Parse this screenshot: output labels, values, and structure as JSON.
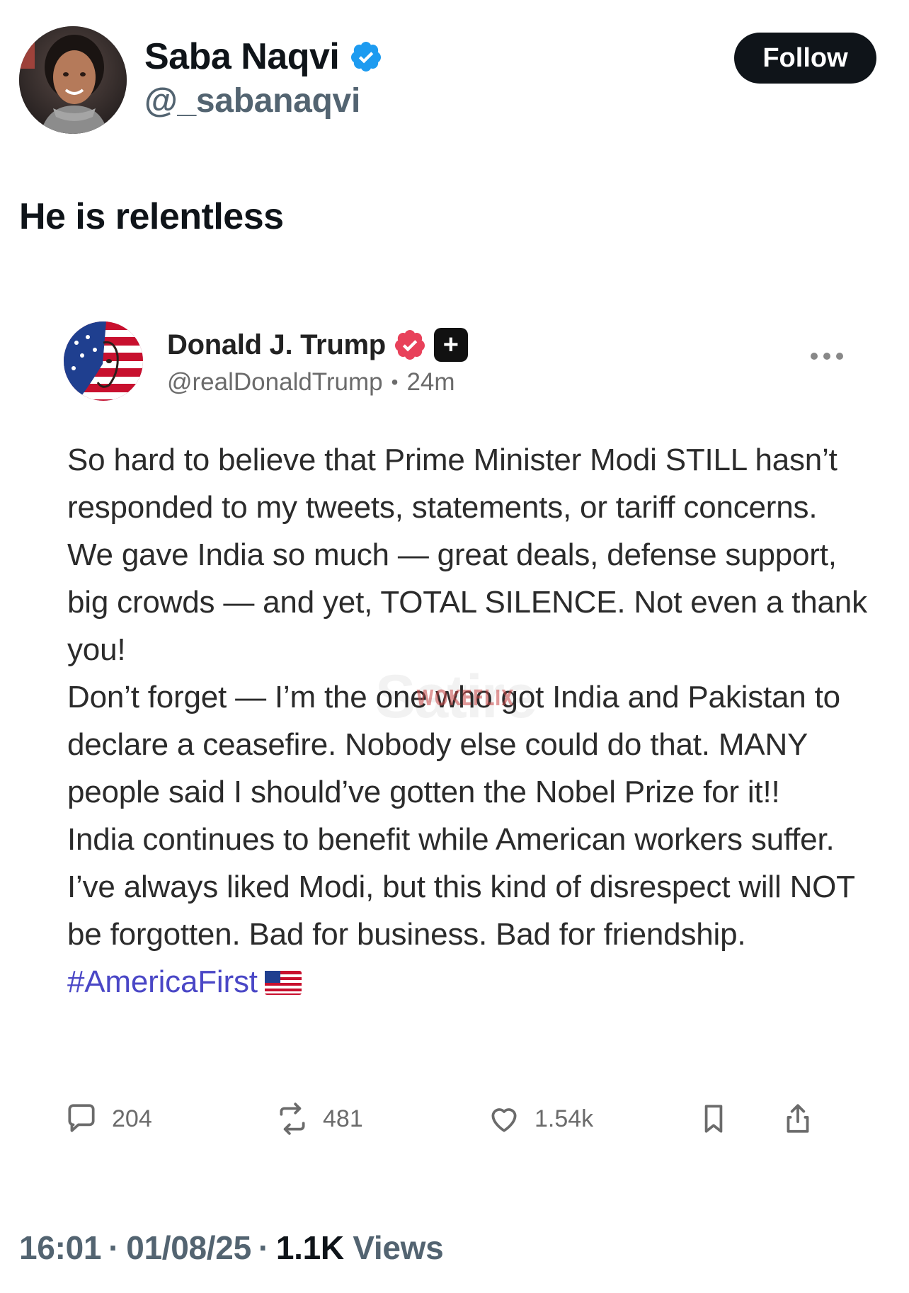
{
  "tweet": {
    "author": {
      "name": "Saba Naqvi",
      "handle": "@_sabanaqvi",
      "verified": true
    },
    "follow_label": "Follow",
    "text": "He is relentless",
    "meta": {
      "time": "16:01",
      "separator": "·",
      "date": "01/08/25",
      "views_count": "1.1K",
      "views_label": "Views"
    }
  },
  "embedded_post": {
    "author": {
      "name": "Donald J. Trump",
      "handle": "@realDonaldTrump",
      "dot": "•",
      "time_ago": "24m",
      "plus_glyph": "+"
    },
    "paragraphs": [
      "So hard to believe that Prime Minister Modi STILL hasn’t responded to my tweets, statements, or tariff concerns. We gave India so much — great deals, defense support, big crowds — and yet, TOTAL SILENCE. Not even a thank you!",
      "Don’t forget — I’m the one who got India and Pakistan to declare a ceasefire. Nobody else could do that. MANY people said I should’ve gotten the Nobel Prize for it!!",
      "India continues to benefit while American workers suffer. I’ve always liked Modi, but this kind of disrespect will NOT be forgotten. Bad for business. Bad for friendship."
    ],
    "hashtag": "#AmericaFirst",
    "flag_icon": "us-flag-icon",
    "watermark": {
      "big": "Satire",
      "small": "WOKEFLIX"
    },
    "actions": {
      "replies": "204",
      "reposts": "481",
      "likes": "1.54k"
    }
  },
  "colors": {
    "verified_blue": "#1d9bf0",
    "inner_badge_pink": "#e8415a",
    "hashtag": "#4a47c6",
    "follow_bg": "#0f1419",
    "meta_gray": "#536471"
  }
}
